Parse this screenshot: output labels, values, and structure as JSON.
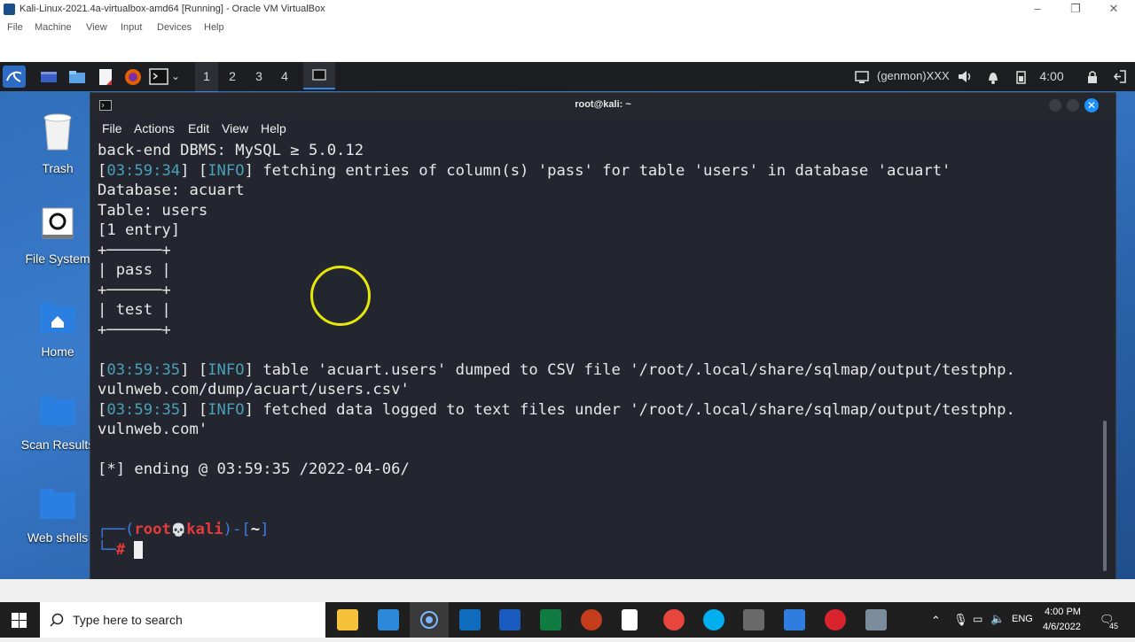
{
  "host": {
    "window_title": "Kali-Linux-2021.4a-virtualbox-amd64 [Running] - Oracle VM VirtualBox",
    "menu": [
      "File",
      "Machine",
      "View",
      "Input",
      "Devices",
      "Help"
    ],
    "controls": {
      "minimize": "–",
      "restore": "❐",
      "close": "✕"
    }
  },
  "kali_panel": {
    "workspaces": [
      "1",
      "2",
      "3",
      "4"
    ],
    "active_workspace": "1",
    "genmon": "(genmon)XXX",
    "clock": "4:00"
  },
  "desktop_icons": [
    {
      "label": "Trash",
      "icon": "trash-icon"
    },
    {
      "label": "File System",
      "icon": "drive-icon"
    },
    {
      "label": "Home",
      "icon": "home-folder-icon"
    },
    {
      "label": "Scan Results",
      "icon": "folder-icon"
    },
    {
      "label": "Web shells",
      "icon": "folder-icon"
    }
  ],
  "terminal": {
    "title": "root@kali: ~",
    "menu": [
      "File",
      "Actions",
      "Edit",
      "View",
      "Help"
    ],
    "close": "✕",
    "lines": {
      "l1": "back-end DBMS: MySQL ≥ 5.0.12",
      "l2_ts": "03:59:34",
      "l2_tag": "INFO",
      "l2_msg": " fetching entries of column(s) 'pass' for table 'users' in database 'acuart'",
      "l3": "Database: acuart",
      "l4": "Table: users",
      "l5": "[1 entry]",
      "l6": "+──────+",
      "l7": "| pass |",
      "l8": "+──────+",
      "l9": "| test |",
      "l10": "+──────+",
      "l11_ts": "03:59:35",
      "l11_tag": "INFO",
      "l11_msg": " table 'acuart.users' dumped to CSV file '/root/.local/share/sqlmap/output/testphp.",
      "l12": "vulnweb.com/dump/acuart/users.csv'",
      "l13_ts": "03:59:35",
      "l13_tag": "INFO",
      "l13_msg": " fetched data logged to text files under '/root/.local/share/sqlmap/output/testphp.",
      "l14": "vulnweb.com'",
      "l15": "[*] ending @ 03:59:35 /2022-04-06/",
      "prompt_user": "root",
      "prompt_skull": "💀",
      "prompt_host": "kali",
      "prompt_dir": "~",
      "prompt_hash": "#"
    }
  },
  "taskbar": {
    "search_placeholder": "Type here to search",
    "language": "ENG",
    "time": "4:00 PM",
    "date": "4/6/2022",
    "notifications": "45"
  }
}
